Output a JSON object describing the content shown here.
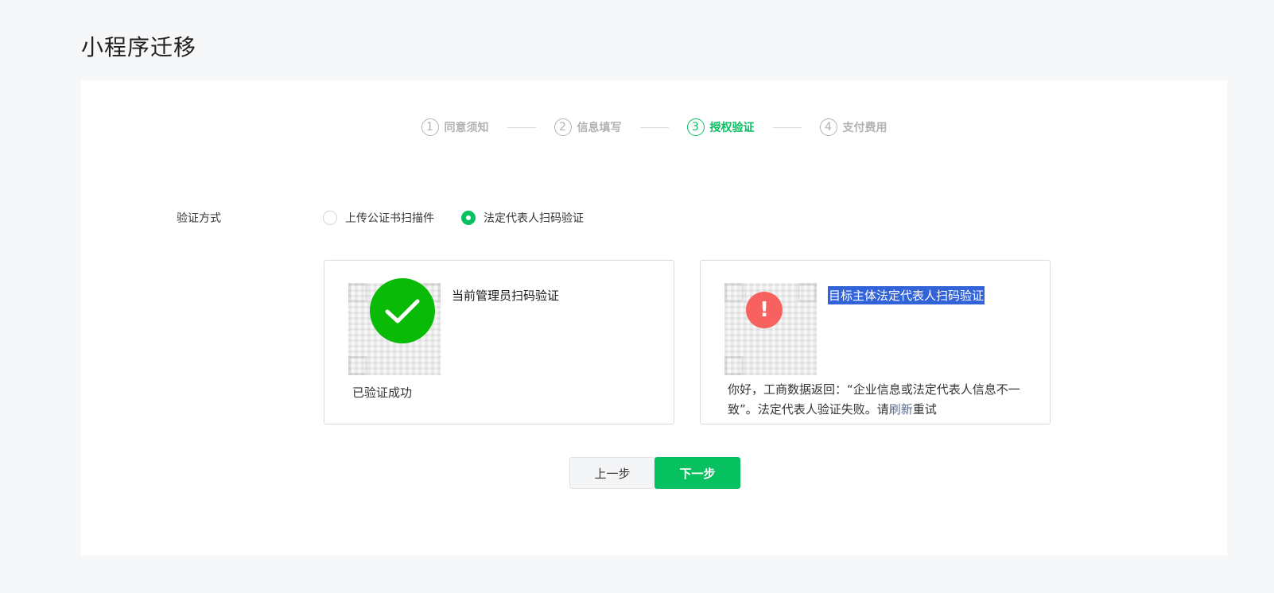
{
  "page": {
    "title": "小程序迁移"
  },
  "steps": [
    {
      "num": "1",
      "label": "同意须知",
      "state": "done"
    },
    {
      "num": "2",
      "label": "信息填写",
      "state": "done"
    },
    {
      "num": "3",
      "label": "授权验证",
      "state": "active"
    },
    {
      "num": "4",
      "label": "支付费用",
      "state": "pending"
    }
  ],
  "form": {
    "method_label": "验证方式",
    "options": [
      {
        "label": "上传公证书扫描件",
        "checked": false
      },
      {
        "label": "法定代表人扫码验证",
        "checked": true
      }
    ]
  },
  "cards": {
    "current_admin": {
      "title": "当前管理员扫码验证",
      "status": "已验证成功",
      "icon": "check-circle-icon"
    },
    "legal_rep": {
      "title": "目标主体法定代表人扫码验证",
      "message_part1": "你好，工商数据返回：“企业信息或法定代表人信息不一致”。法定代表人验证失败。请",
      "refresh_link": "刷新",
      "message_part2": "重试",
      "icon": "warning-circle-icon"
    }
  },
  "buttons": {
    "prev": "上一步",
    "next": "下一步"
  },
  "colors": {
    "primary": "#07c160",
    "success": "#09bb07",
    "warn": "#f76260",
    "link": "#576b95"
  }
}
